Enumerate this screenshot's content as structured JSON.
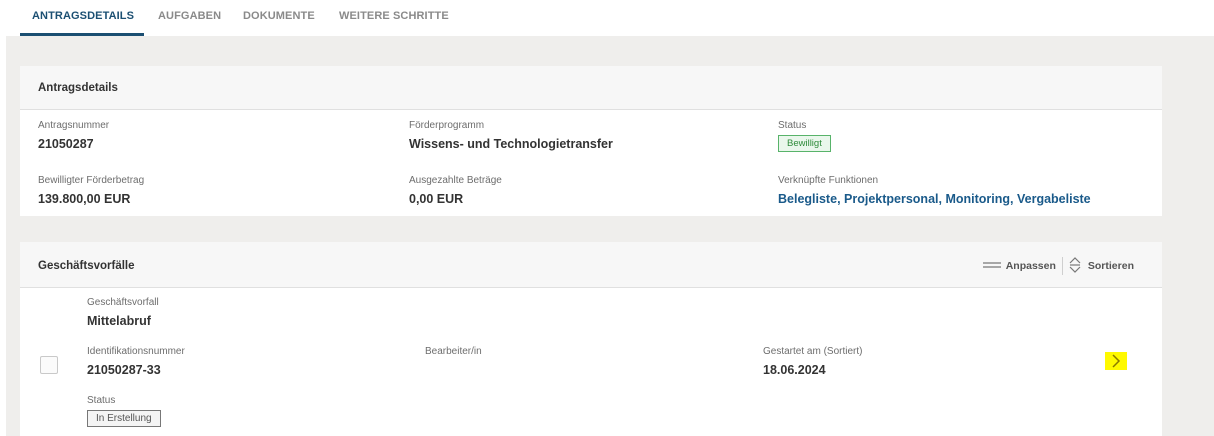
{
  "tabs": [
    {
      "label": "ANTRAGSDETAILS",
      "active": true
    },
    {
      "label": "AUFGABEN"
    },
    {
      "label": "DOKUMENTE"
    },
    {
      "label": "WEITERE SCHRITTE"
    }
  ],
  "antragsdetails": {
    "title": "Antragsdetails",
    "antragsnummer_label": "Antragsnummer",
    "antragsnummer_value": "21050287",
    "foerderprogramm_label": "Förderprogramm",
    "foerderprogramm_value": "Wissens- und Technologietransfer",
    "status_label": "Status",
    "status_value": "Bewilligt",
    "betrag_label": "Bewilligter Förderbetrag",
    "betrag_value": "139.800,00 EUR",
    "ausgezahlt_label": "Ausgezahlte Beträge",
    "ausgezahlt_value": "0,00 EUR",
    "funktionen_label": "Verknüpfte Funktionen",
    "funktionen": [
      "Belegliste",
      "Projektpersonal",
      "Monitoring",
      "Vergabeliste"
    ]
  },
  "geschaeftsvorfaelle": {
    "title": "Geschäftsvorfälle",
    "anpassen_label": "Anpassen",
    "sortieren_label": "Sortieren",
    "item": {
      "vorfall_label": "Geschäftsvorfall",
      "vorfall_value": "Mittelabruf",
      "id_label": "Identifikationsnummer",
      "id_value": "21050287-33",
      "bearbeiter_label": "Bearbeiter/in",
      "gestartet_label": "Gestartet am (Sortiert)",
      "gestartet_value": "18.06.2024",
      "status_label": "Status",
      "status_value": "In Erstellung"
    }
  },
  "colors": {
    "accent": "#1b4f72",
    "link": "#1a5a8a",
    "status_green": "#2e8b3a",
    "highlight": "#fff900",
    "background": "#efeeec"
  },
  "icons": [
    "equals-icon",
    "sort-icon",
    "chevron-right-icon"
  ]
}
